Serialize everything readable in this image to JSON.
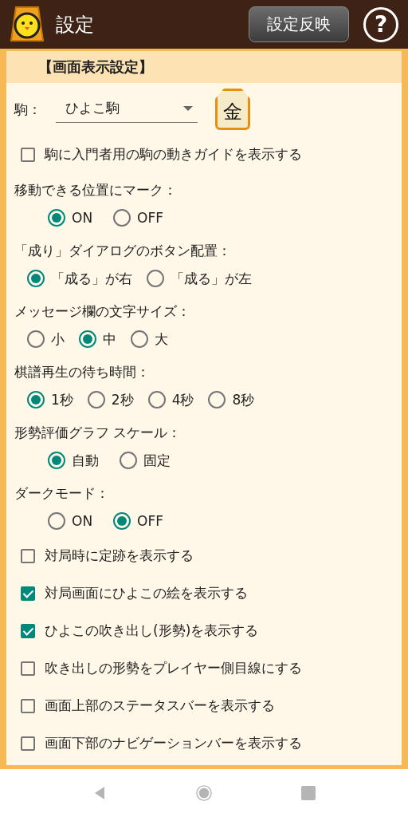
{
  "app_bar": {
    "title": "設定",
    "apply_button": "設定反映",
    "help_button": "?"
  },
  "section": {
    "title": "【画面表示設定】"
  },
  "settings": [
    {
      "kind": "select",
      "label": "駒：",
      "value": "ひよこ駒"
    },
    {
      "kind": "checkbox",
      "label": "駒に入門者用の駒の動きガイドを表示する",
      "checked": false
    },
    {
      "kind": "radio",
      "label": "移動できる位置にマーク：",
      "options": [
        {
          "label": "ON",
          "selected": true
        },
        {
          "label": "OFF",
          "selected": false
        }
      ]
    },
    {
      "kind": "radio",
      "label": "「成り」ダイアログのボタン配置：",
      "options": [
        {
          "label": "「成る」が右",
          "selected": true
        },
        {
          "label": "「成る」が左",
          "selected": false
        }
      ]
    },
    {
      "kind": "radio",
      "label": "メッセージ欄の文字サイズ：",
      "options": [
        {
          "label": "小",
          "selected": false
        },
        {
          "label": "中",
          "selected": true
        },
        {
          "label": "大",
          "selected": false
        }
      ]
    },
    {
      "kind": "radio",
      "label": "棋譜再生の待ち時間：",
      "options": [
        {
          "label": "1秒",
          "selected": true
        },
        {
          "label": "2秒",
          "selected": false
        },
        {
          "label": "4秒",
          "selected": false
        },
        {
          "label": "8秒",
          "selected": false
        }
      ]
    },
    {
      "kind": "radio",
      "label": "形勢評価グラフ スケール：",
      "options": [
        {
          "label": "自動",
          "selected": true
        },
        {
          "label": "固定",
          "selected": false
        }
      ]
    },
    {
      "kind": "radio",
      "label": "ダークモード：",
      "options": [
        {
          "label": "ON",
          "selected": false
        },
        {
          "label": "OFF",
          "selected": true
        }
      ]
    },
    {
      "kind": "checkbox",
      "label": "対局時に定跡を表示する",
      "checked": false
    },
    {
      "kind": "checkbox",
      "label": "対局画面にひよこの絵を表示する",
      "checked": true
    },
    {
      "kind": "checkbox",
      "label": "ひよこの吹き出し(形勢)を表示する",
      "checked": true
    },
    {
      "kind": "checkbox",
      "label": "吹き出しの形勢をプレイヤー側目線にする",
      "checked": false
    },
    {
      "kind": "checkbox",
      "label": "画面上部のステータスバーを表示する",
      "checked": false
    },
    {
      "kind": "checkbox",
      "label": "画面下部のナビゲーションバーを表示する",
      "checked": false
    }
  ],
  "piece_preview": {
    "glyph": "金"
  }
}
